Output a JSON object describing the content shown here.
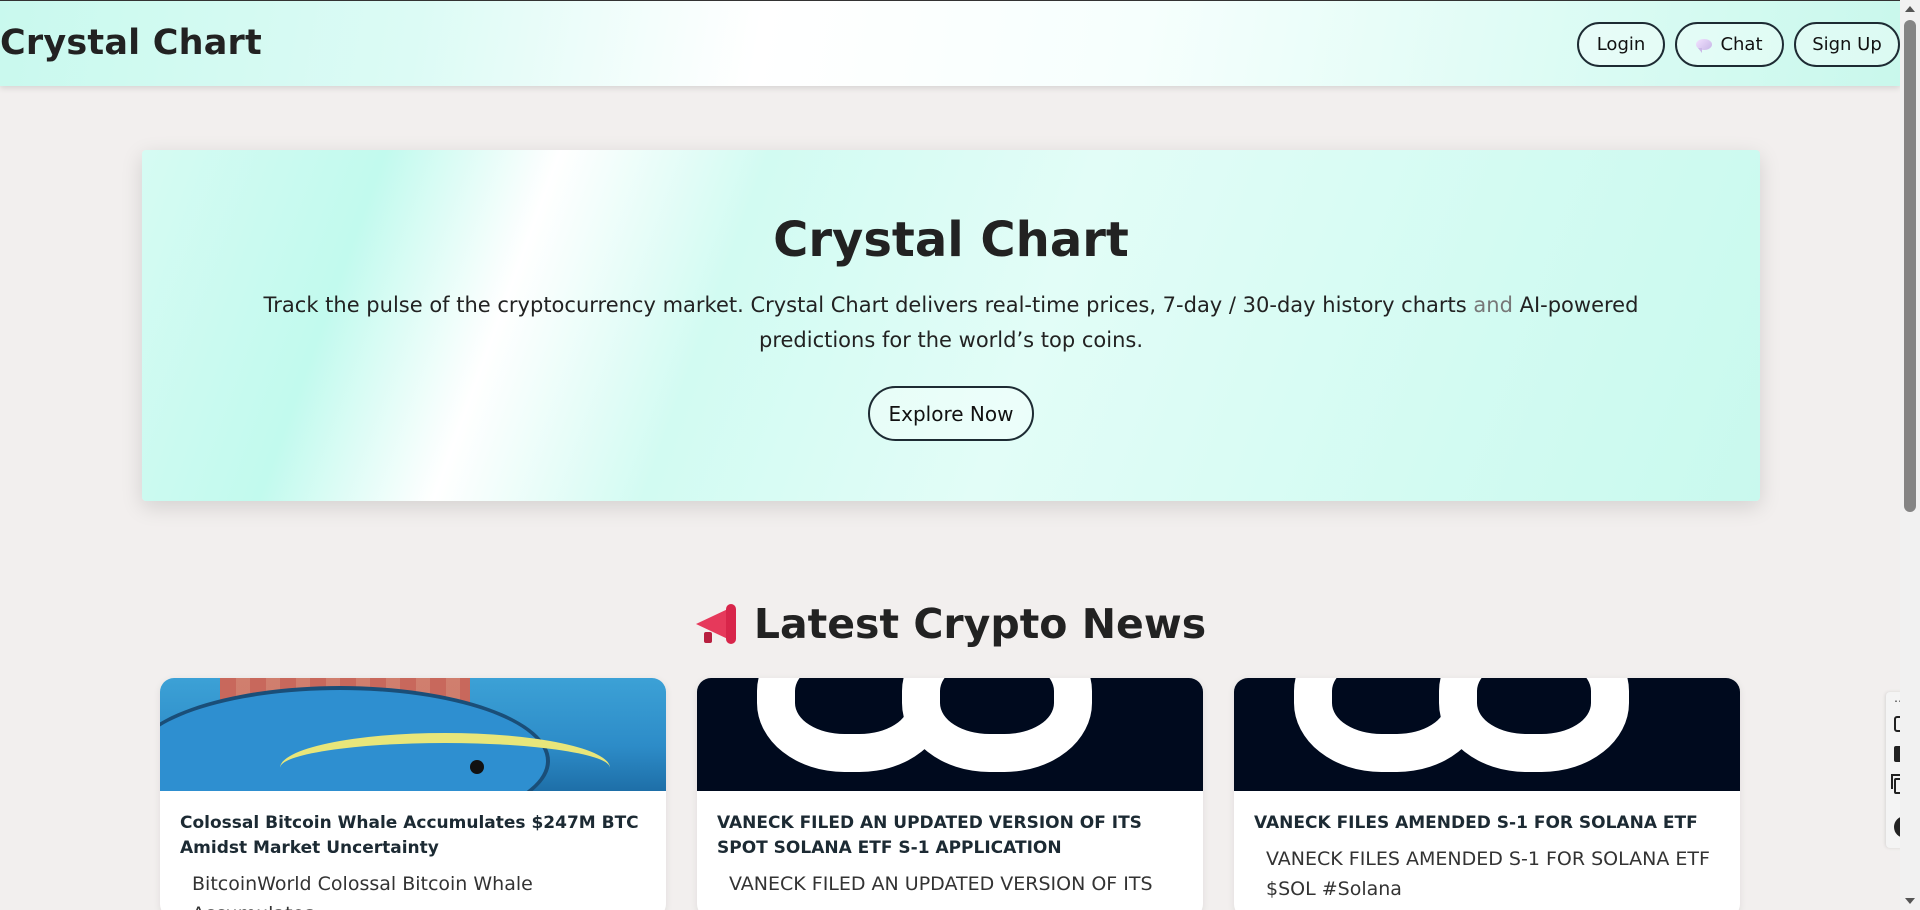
{
  "header": {
    "brand": "Crystal Chart",
    "nav": {
      "login": "Login",
      "chat": "Chat",
      "signup": "Sign Up"
    }
  },
  "hero": {
    "title": "Crystal Chart",
    "desc_part1": "Track the pulse of the cryptocurrency market. Crystal Chart delivers real-time prices, 7-day / 30-day history charts",
    "desc_and": "and",
    "desc_part2": "AI-powered predictions for the world’s top coins.",
    "cta": "Explore Now"
  },
  "news": {
    "heading": "Latest Crypto News",
    "articles": [
      {
        "title": "Colossal Bitcoin Whale Accumulates $247M BTC Amidst Market Uncertainty",
        "excerpt": "BitcoinWorld Colossal Bitcoin Whale Accumulates"
      },
      {
        "title": "VANECK FILED AN UPDATED VERSION OF ITS SPOT SOLANA ETF S-1 APPLICATION",
        "excerpt": "VANECK FILED AN UPDATED VERSION OF ITS"
      },
      {
        "title": "VANECK FILES AMENDED S-1 FOR SOLANA ETF",
        "excerpt": "VANECK FILES AMENDED S-1 FOR SOLANA ETF $SOL #Solana"
      }
    ]
  },
  "icons": {
    "chat": "speech-bubble-icon",
    "news_heading": "megaphone-icon"
  },
  "colors": {
    "accent": "#c9f9ee",
    "page_background": "#f2efee",
    "text": "#222222"
  }
}
